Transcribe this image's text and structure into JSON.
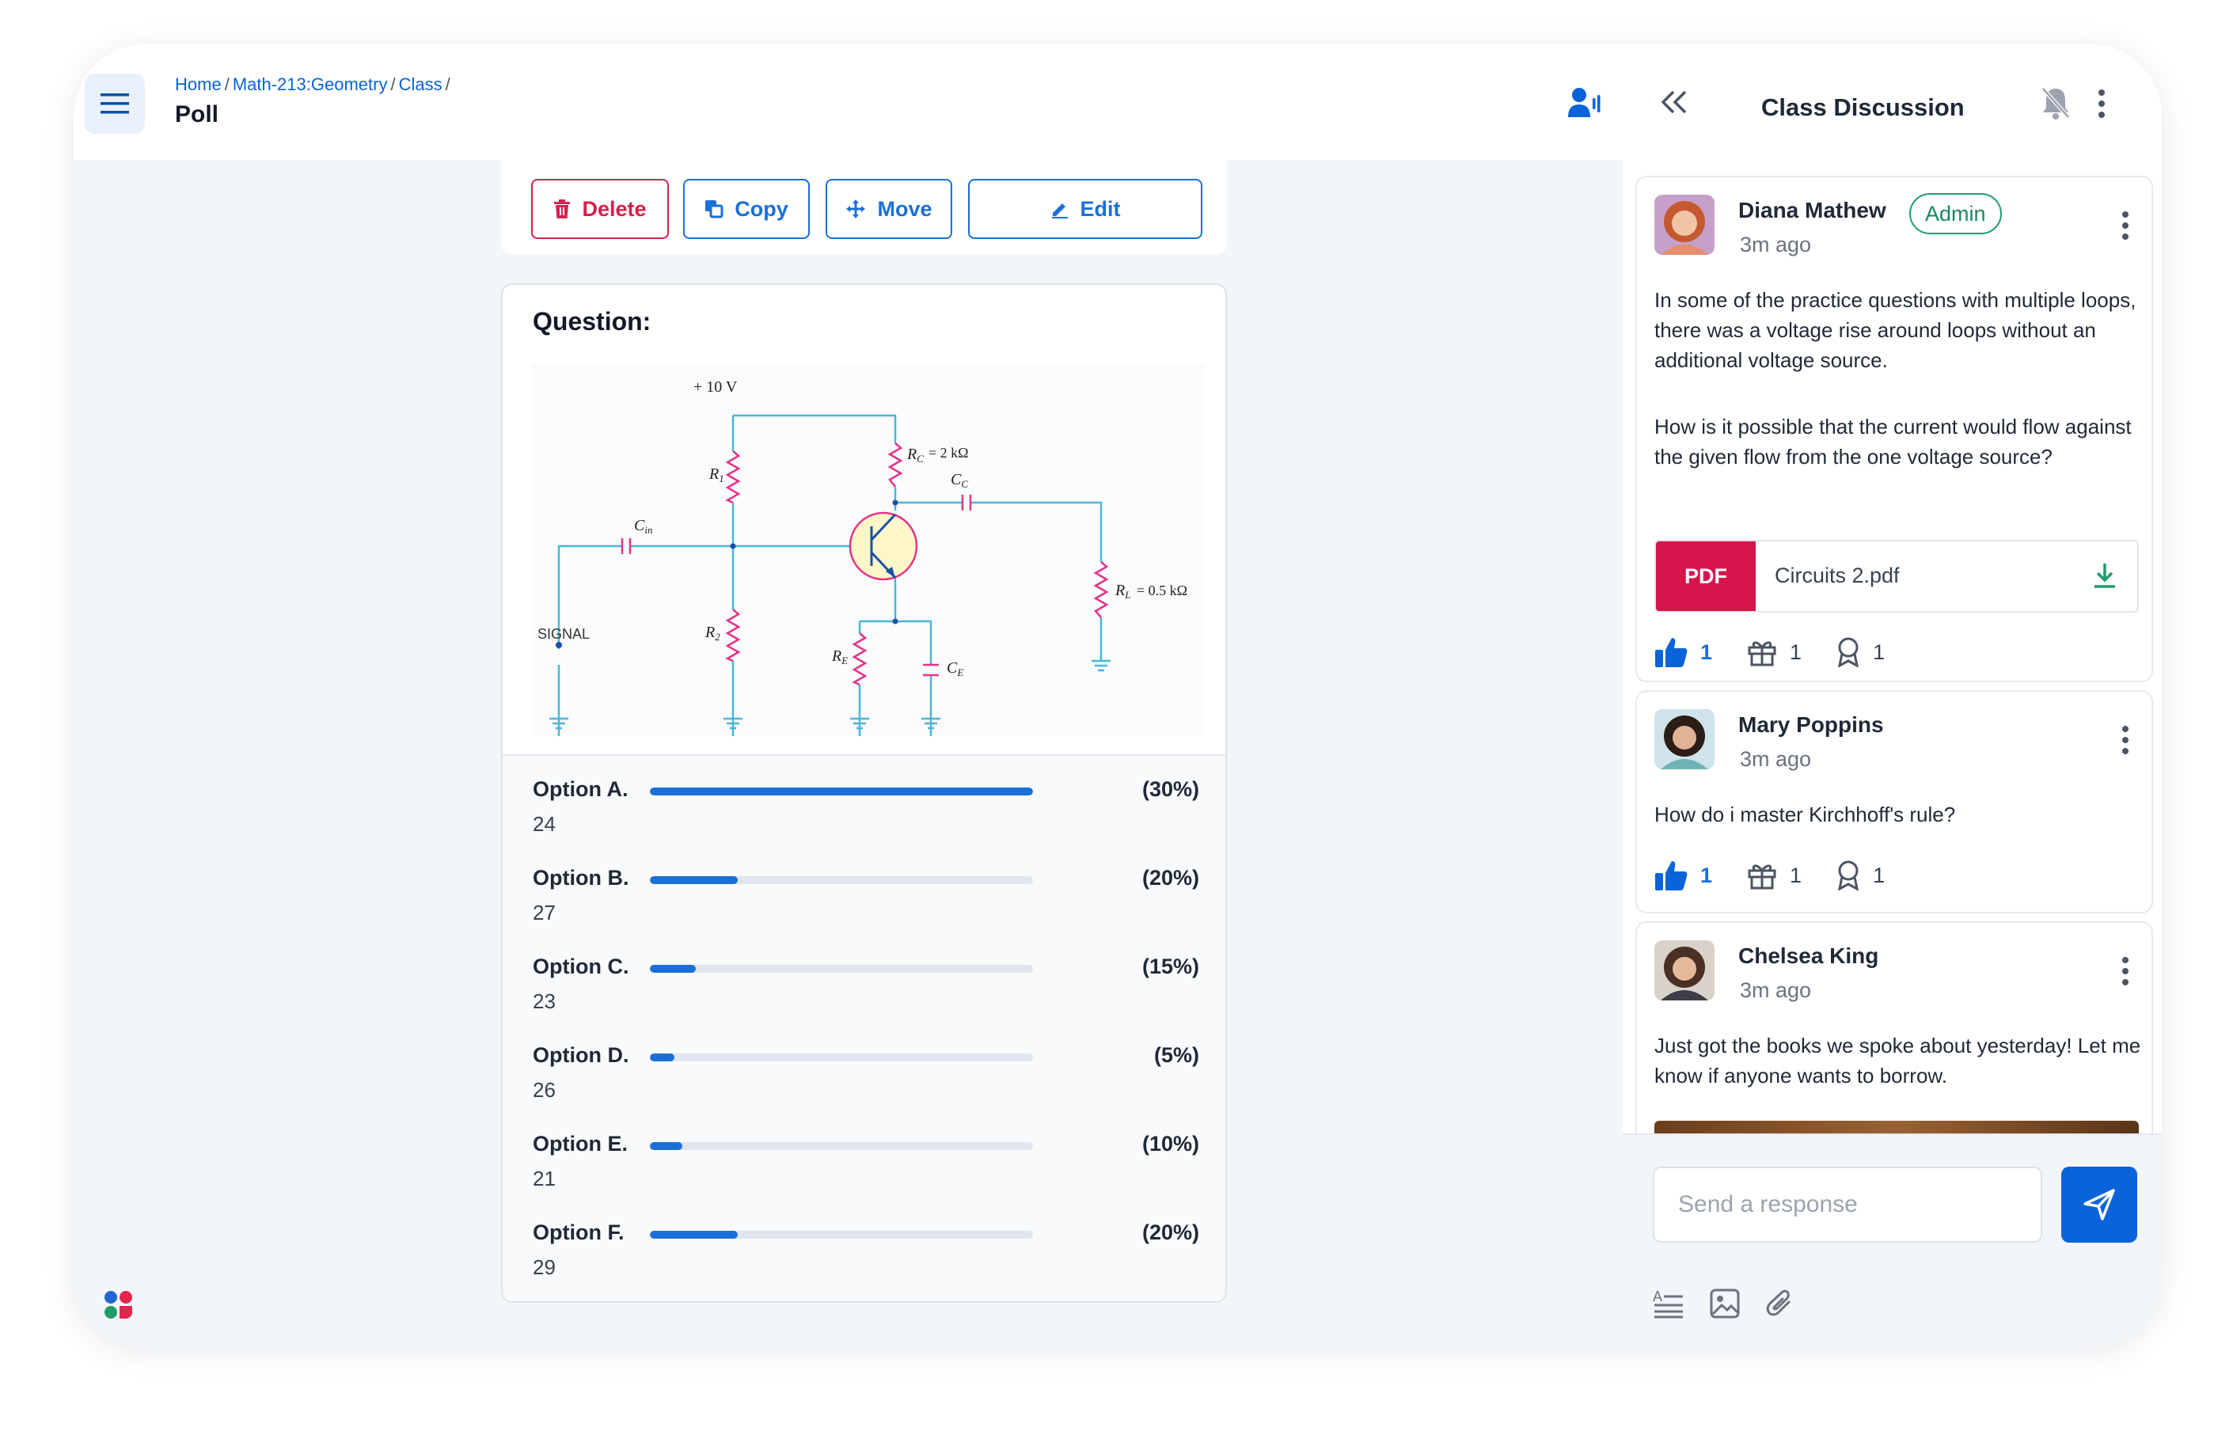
{
  "header": {
    "breadcrumb": [
      "Home",
      "Math-213:Geometry",
      "Class"
    ],
    "separator": "/",
    "title": "Poll"
  },
  "toolbar": {
    "delete_label": "Delete",
    "copy_label": "Copy",
    "move_label": "Move",
    "edit_label": "Edit"
  },
  "question": {
    "label": "Question:",
    "circuit": {
      "supply": "+ 10 V",
      "rc": "= 2 kΩ",
      "rl": "= 0.5 kΩ",
      "signal": "SIGNAL"
    }
  },
  "poll": {
    "options": [
      {
        "label": "Option A.",
        "percent_text": "(30%)",
        "count": "24",
        "fill": 1.0
      },
      {
        "label": "Option B.",
        "percent_text": "(20%)",
        "count": "27",
        "fill": 0.23
      },
      {
        "label": "Option C.",
        "percent_text": "(15%)",
        "count": "23",
        "fill": 0.12
      },
      {
        "label": "Option D.",
        "percent_text": "(5%)",
        "count": "26",
        "fill": 0.065
      },
      {
        "label": "Option E.",
        "percent_text": "(10%)",
        "count": "21",
        "fill": 0.085
      },
      {
        "label": "Option F.",
        "percent_text": "(20%)",
        "count": "29",
        "fill": 0.23
      }
    ]
  },
  "discussion": {
    "title": "Class Discussion",
    "posts": [
      {
        "author": "Diana Mathew",
        "badge": "Admin",
        "time": "3m ago",
        "text": [
          "In some of the practice questions with multiple loops, there was a voltage rise around loops without an additional voltage source.",
          "How is it possible that the current would flow against the given flow from the one voltage source?"
        ],
        "attachment": {
          "type": "PDF",
          "name": "Circuits 2.pdf"
        },
        "likes": "1",
        "gifts": "1",
        "awards": "1"
      },
      {
        "author": "Mary Poppins",
        "time": "3m ago",
        "text": [
          "How do i master Kirchhoff's rule?"
        ],
        "likes": "1",
        "gifts": "1",
        "awards": "1"
      },
      {
        "author": "Chelsea King",
        "time": "3m ago",
        "text": [
          "Just got the books we spoke about yesterday! Let me know if anyone wants to borrow."
        ]
      }
    ],
    "composer": {
      "placeholder": "Send a response"
    }
  },
  "colors": {
    "accent": "#0a63d8",
    "danger": "#d6204e",
    "admin": "#1f9d6b",
    "pdf": "#d6164a"
  }
}
